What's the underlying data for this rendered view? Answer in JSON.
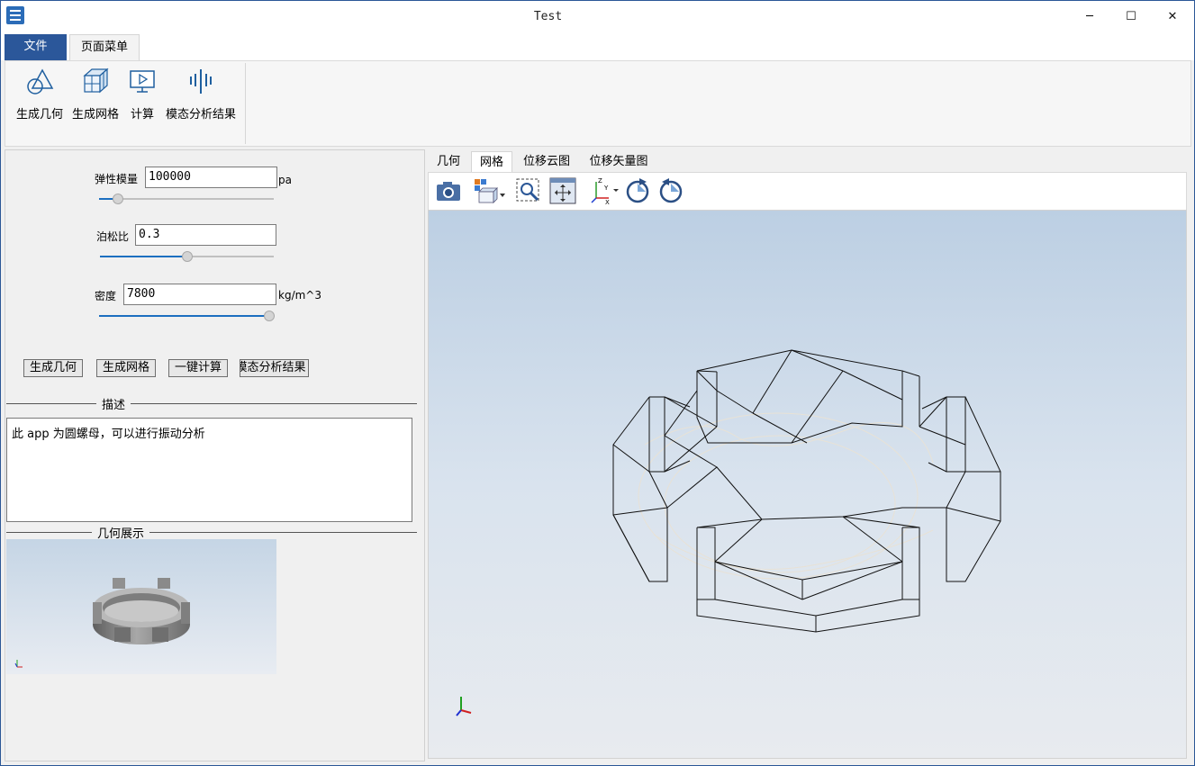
{
  "window": {
    "title": "Test",
    "minimize": "─",
    "maximize": "☐",
    "close": "✕"
  },
  "ribbon": {
    "tabs": [
      "文件",
      "页面菜单"
    ],
    "buttons": [
      "生成几何",
      "生成网格",
      "计算",
      "模态分析结果"
    ]
  },
  "params": {
    "elastic": {
      "label": "弹性模量",
      "value": "100000",
      "unit": "pa",
      "slider": 0.08
    },
    "poisson": {
      "label": "泊松比",
      "value": "0.3",
      "slider": 0.5
    },
    "density": {
      "label": "密度",
      "value": "7800",
      "unit": "kg/m^3",
      "slider": 1.0
    }
  },
  "actions": [
    "生成几何",
    "生成网格",
    "一键计算",
    "模态分析结果"
  ],
  "description": {
    "title": "描述",
    "text": "此 app 为圆螺母，可以进行振动分析"
  },
  "preview": {
    "title": "几何展示"
  },
  "view_tabs": [
    "几何",
    "网格",
    "位移云图",
    "位移矢量图"
  ],
  "active_view_tab": "网格",
  "toolbar": [
    "camera-icon",
    "view-cube-icon",
    "zoom-box-icon",
    "fit-all-icon",
    "axis-orientation-icon",
    "rotate-cw-icon",
    "rotate-ccw-icon"
  ],
  "colors": {
    "accent": "#2b579a",
    "slider": "#1c6fc0"
  }
}
